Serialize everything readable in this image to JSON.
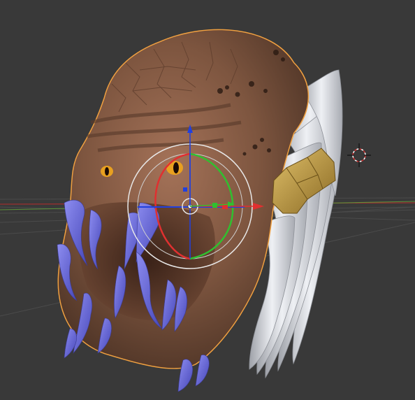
{
  "viewport": {
    "type": "blender-3d-viewport",
    "background_color": "#393939",
    "grid_color": "#4a4a4a",
    "x_axis_color": "#9a2f2f",
    "y_axis_color": "#5c8f3a"
  },
  "scene": {
    "object": "creature-head-mesh",
    "selected": true,
    "selection_outline_color": "#f0a040",
    "skin_color": "#8a5e45",
    "teeth_color": "#6c6ce0",
    "hair_color": "#d8dadf",
    "band_color": "#c7a34e",
    "eye_color": "#e8a020"
  },
  "transform_gizmo": {
    "mode": "rotate",
    "x_color": "#e03030",
    "y_color": "#30c030",
    "z_color": "#2040e0",
    "view_ring_color": "#e8e8e8"
  },
  "cursor_3d": {
    "visible": true,
    "color": "#d03030"
  }
}
